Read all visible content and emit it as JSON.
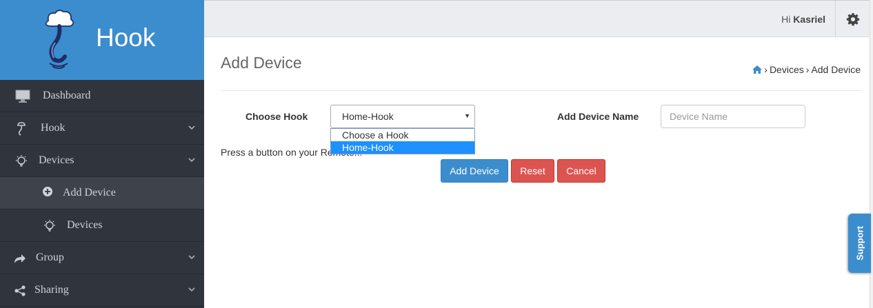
{
  "app": {
    "name": "Hook"
  },
  "topbar": {
    "greeting_prefix": "Hi",
    "user_name": "Kasriel"
  },
  "sidebar": {
    "items": [
      {
        "label": "Dashboard",
        "icon": "monitor-icon"
      },
      {
        "label": "Hook",
        "icon": "hook-icon",
        "expandable": true
      },
      {
        "label": "Devices",
        "icon": "bulb-icon",
        "expandable": true,
        "expanded": true
      },
      {
        "label": "Add Device",
        "icon": "plus-circle-icon",
        "sub": true,
        "active": true
      },
      {
        "label": "Devices",
        "icon": "bulb-icon",
        "sub": true
      },
      {
        "label": "Group",
        "icon": "share-arrow-icon",
        "expandable": true
      },
      {
        "label": "Sharing",
        "icon": "share-icon",
        "expandable": true
      }
    ]
  },
  "page": {
    "title": "Add Device",
    "breadcrumb": {
      "home_icon": "home-icon",
      "items": [
        "Devices",
        "Add Device"
      ],
      "separator": "›"
    }
  },
  "form": {
    "hook_label": "Choose Hook",
    "hook_selected": "Home-Hook",
    "hook_options": [
      "Choose a Hook",
      "Home-Hook"
    ],
    "device_name_label": "Add Device Name",
    "device_name_placeholder": "Device Name",
    "device_name_value": "",
    "hint": "Press a button on your Remote..."
  },
  "buttons": {
    "add": "Add Device",
    "reset": "Reset",
    "cancel": "Cancel"
  },
  "support": {
    "label": "Support"
  },
  "colors": {
    "primary": "#3c8dcd",
    "danger": "#dc5450",
    "sidebar": "#2f343d",
    "topbar": "#ecedf0"
  }
}
